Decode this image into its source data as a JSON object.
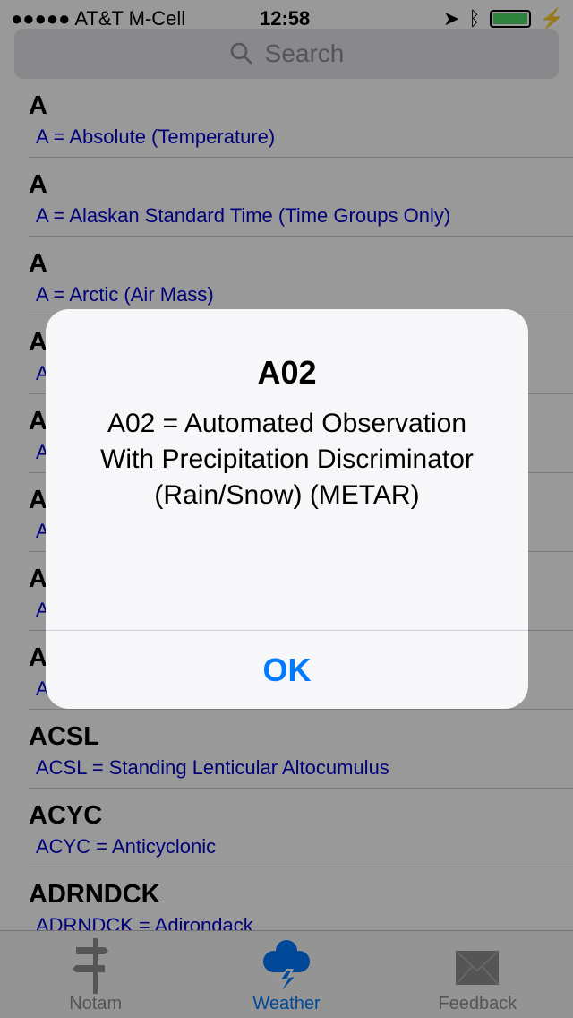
{
  "status": {
    "carrier": "●●●●● AT&T M-Cell",
    "time": "12:58"
  },
  "search": {
    "placeholder": "Search"
  },
  "list": [
    {
      "title": "A",
      "subtitle": "A = Absolute (Temperature)"
    },
    {
      "title": "A",
      "subtitle": "A = Alaskan Standard Time (Time Groups Only)"
    },
    {
      "title": "A",
      "subtitle": "A = Arctic (Air Mass)"
    },
    {
      "title": "A",
      "subtitle": "A"
    },
    {
      "title": "A",
      "subtitle": "A"
    },
    {
      "title": "A",
      "subtitle": "A"
    },
    {
      "title": "A",
      "subtitle": "A"
    },
    {
      "title": "A",
      "subtitle": "A"
    },
    {
      "title": "ACSL",
      "subtitle": "ACSL = Standing Lenticular Altocumulus"
    },
    {
      "title": "ACYC",
      "subtitle": "ACYC = Anticyclonic"
    },
    {
      "title": "ADRNDCK",
      "subtitle": "ADRNDCK = Adirondack"
    }
  ],
  "tabs": [
    {
      "label": "Notam",
      "icon": "signpost-icon",
      "active": false
    },
    {
      "label": "Weather",
      "icon": "storm-cloud-icon",
      "active": true
    },
    {
      "label": "Feedback",
      "icon": "envelope-icon",
      "active": false
    }
  ],
  "alert": {
    "title": "A02",
    "message": "A02 = Automated Observation With Precipitation Discriminator (Rain/Snow) (METAR)",
    "button": "OK"
  },
  "colors": {
    "accent": "#007aff",
    "subtitle": "#0000cc"
  }
}
